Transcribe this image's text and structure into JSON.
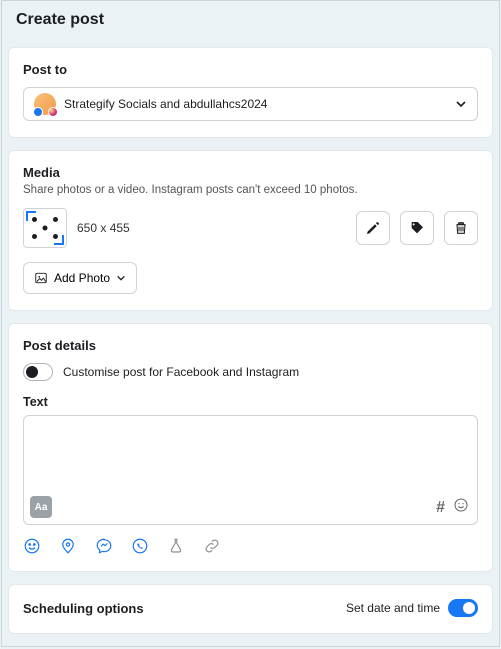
{
  "header": {
    "title": "Create post"
  },
  "post_to": {
    "section_title": "Post to",
    "selected_label": "Strategify Socials and abdullahcs2024"
  },
  "media": {
    "section_title": "Media",
    "subtitle": "Share photos or a video. Instagram posts can't exceed 10 photos.",
    "thumbnail_dimensions": "650 x 455",
    "add_photo_label": "Add Photo"
  },
  "details": {
    "section_title": "Post details",
    "customise_label": "Customise post for Facebook and Instagram",
    "customise_on": false,
    "text_label": "Text",
    "text_value": "",
    "hashtag_symbol": "#",
    "aa_label": "Aa"
  },
  "scheduling": {
    "section_title": "Scheduling options",
    "set_date_label": "Set date and time",
    "set_date_on": true
  }
}
